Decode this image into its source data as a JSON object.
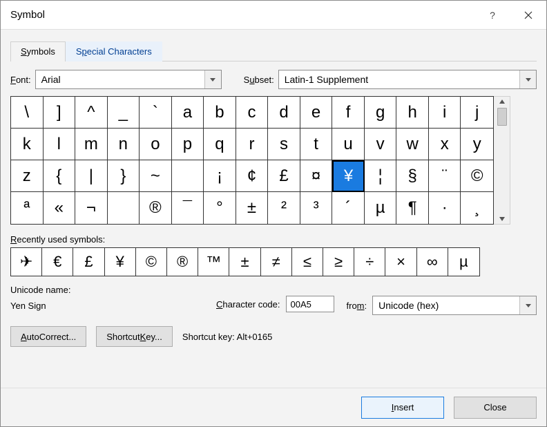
{
  "window": {
    "title": "Symbol"
  },
  "tabs": {
    "t0": "Symbols",
    "t0_u": "S",
    "t1": "Special Characters",
    "t1_u": "p"
  },
  "font": {
    "label": "Font:",
    "label_u": "F",
    "value": "Arial"
  },
  "subset": {
    "label": "Subset:",
    "label_u": "u",
    "value": "Latin-1 Supplement"
  },
  "grid": {
    "cells": [
      "\\",
      "]",
      "^",
      "_",
      "`",
      "a",
      "b",
      "c",
      "d",
      "e",
      "f",
      "g",
      "h",
      "i",
      "j",
      "k",
      "l",
      "m",
      "n",
      "o",
      "p",
      "q",
      "r",
      "s",
      "t",
      "u",
      "v",
      "w",
      "x",
      "y",
      "z",
      "{",
      "|",
      "}",
      "~",
      "",
      "¡",
      "¢",
      "£",
      "¤",
      "¥",
      "¦",
      "§",
      "¨",
      "©",
      "ª",
      "«",
      "¬",
      "­",
      "®",
      "¯",
      "°",
      "±",
      "²",
      "³",
      "´",
      "µ",
      "¶",
      "·",
      "¸"
    ],
    "selected_index": 40
  },
  "recent": {
    "label": "Recently used symbols:",
    "label_u": "R",
    "cells": [
      "✈",
      "€",
      "£",
      "¥",
      "©",
      "®",
      "™",
      "±",
      "≠",
      "≤",
      "≥",
      "÷",
      "×",
      "∞",
      "µ"
    ]
  },
  "uname": {
    "label": "Unicode name:",
    "value": "Yen Sign"
  },
  "charcode": {
    "label": "Character code:",
    "label_u": "C",
    "value": "00A5"
  },
  "from": {
    "label": "from:",
    "label_u": "m",
    "value": "Unicode (hex)"
  },
  "buttons": {
    "autocorrect": "AutoCorrect...",
    "autocorrect_u": "A",
    "shortcutkey": "Shortcut Key...",
    "shortcutkey_u": "K",
    "shortcut_label": "Shortcut key: Alt+0165",
    "insert": "Insert",
    "insert_u": "I",
    "close": "Close"
  }
}
